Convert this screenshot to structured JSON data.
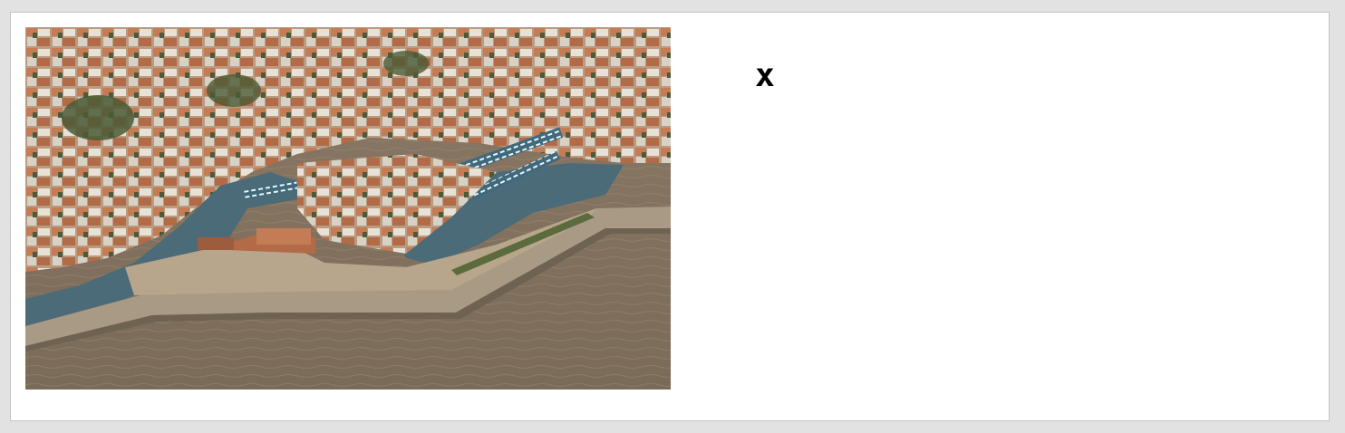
{
  "dialog": {
    "close_label": "x"
  },
  "image": {
    "subject": "aerial-view-harbor-town"
  },
  "colors": {
    "background": "#e2e2e2",
    "panel": "#ffffff",
    "border": "#c4c4c4",
    "close_icon": "#000000"
  }
}
